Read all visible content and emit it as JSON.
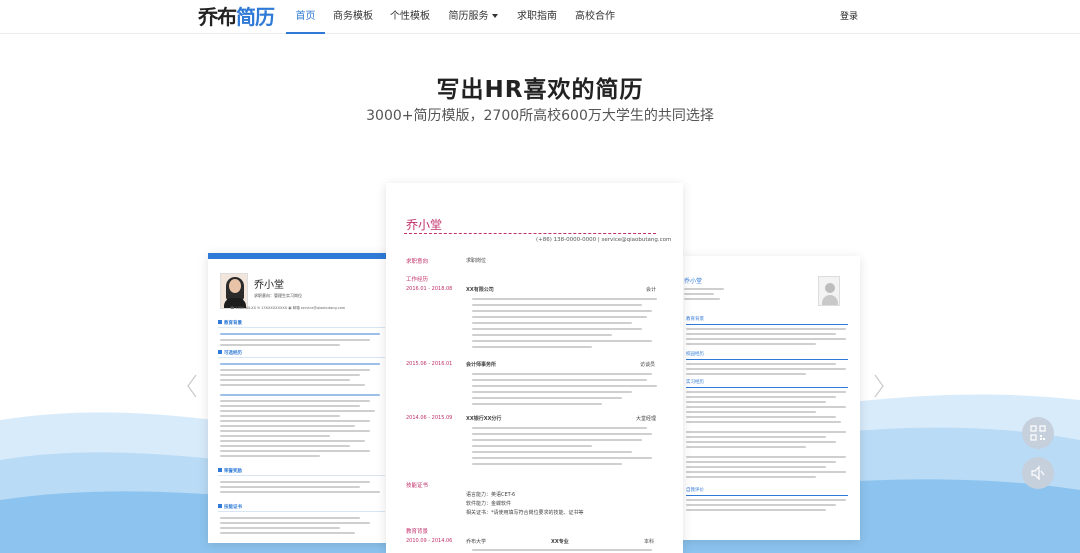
{
  "nav": {
    "logo_part1": "乔布",
    "logo_part2": "简历",
    "items": [
      {
        "label": "首页",
        "active": true
      },
      {
        "label": "商务模板",
        "active": false
      },
      {
        "label": "个性模板",
        "active": false
      },
      {
        "label": "简历服务",
        "active": false,
        "dropdown": true
      },
      {
        "label": "求职指南",
        "active": false
      },
      {
        "label": "高校合作",
        "active": false
      }
    ],
    "login": "登录"
  },
  "hero": {
    "title": "写出HR喜欢的简历",
    "subtitle": "3000+简历模版，2700所高校600万大学生的共同选择"
  },
  "center_resume": {
    "name": "乔小堂",
    "contact": "(+86) 138-0000-0000  |  service@qiaobutang.com",
    "sections": {
      "intent": "求职意向",
      "intent_value": "求职岗位",
      "work": "工作经历",
      "skills": "技能证书",
      "education": "教育背景"
    },
    "work": [
      {
        "date": "2016.01 - 2018.08",
        "company": "XX有限公司",
        "role": "会计"
      },
      {
        "date": "2015.06 - 2016.01",
        "company": "会计师事务所",
        "role": "访谈员"
      },
      {
        "date": "2014.06 - 2015.09",
        "company": "XX银行XX分行",
        "role": "大堂经理"
      }
    ],
    "skills_lines": [
      "语言能力：英语CET-6",
      "软件能力：金蝶软件",
      "相关证书：*请使用填写符合岗位要求的技能、证书等"
    ],
    "education": {
      "date": "2010.09 - 2014.06",
      "school": "乔布大学",
      "major": "XX专业",
      "degree": "本科"
    }
  },
  "left_resume": {
    "name": "乔小堂",
    "intent": "求职意向：管理生实习岗位",
    "contact": "☎ 1580-XX-XX     ✉ 13XXXXXXXXX     ▣ 邮箱     service@qiaobutang.com",
    "sections": [
      "教育背景",
      "可选经历",
      "荣誉奖励",
      "技能证书"
    ]
  },
  "right_resume": {
    "name": "乔小堂",
    "sections": [
      "教育背景",
      "校园经历",
      "实习经历",
      "自我评价"
    ]
  },
  "float_buttons": [
    "qrcode-icon",
    "speaker-icon"
  ],
  "colors": {
    "accent": "#2f7ad6",
    "resume_accent": "#c0306a"
  }
}
